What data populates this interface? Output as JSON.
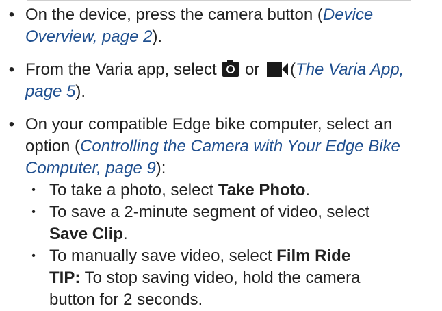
{
  "bullets": [
    {
      "lines": [
        {
          "pre": "On the device, press the camera button (",
          "link": "Device"
        },
        {
          "link": "Overview, page 2",
          "post": ")."
        }
      ]
    },
    {
      "lines": [
        {
          "pre": "From the Varia app, select",
          "mid": "or",
          "link": "The Varia App,"
        },
        {
          "link": "page 5",
          "post": ")."
        }
      ]
    },
    {
      "lines": [
        {
          "text": "On your compatible Edge bike computer, select an"
        },
        {
          "pre": "option (",
          "link": "Controlling the Camera with Your Edge Bike"
        },
        {
          "link": "Computer, page 9",
          "post": "):"
        }
      ],
      "sub": [
        {
          "pre": "To take a photo, select ",
          "bold": "Take Photo",
          "post": "."
        },
        {
          "pre": "To save a 2-minute segment of video, select",
          "bold2": "Save Clip",
          "post2": "."
        },
        {
          "pre": "To manually save video, select ",
          "bold": "Film Ride",
          "tip_label": "TIP:",
          "tip_text": " To stop saving video, hold the camera",
          "tip_text2": "button for 2 seconds."
        }
      ]
    }
  ],
  "icons": {
    "photo": "camera-icon",
    "video": "video-camera-icon"
  }
}
